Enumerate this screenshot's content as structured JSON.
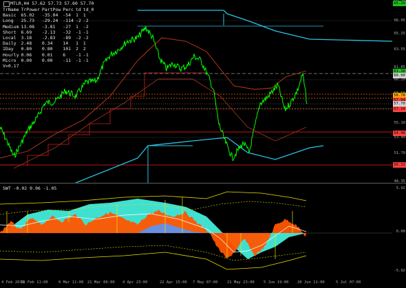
{
  "main": {
    "title": "MTLR,H4  57.62 57.73 57.60 57.70",
    "info_header": [
      "TrName",
      "TrPower",
      "PartPow",
      "Perc",
      "td",
      "td_0"
    ],
    "info_rows": [
      [
        "Basic",
        "65.02",
        "-35.04",
        "-54",
        "1",
        "1"
      ],
      [
        "Long",
        "25.73",
        "-29.24",
        "-114",
        "-2",
        "-2"
      ],
      [
        "Medium",
        "13.08",
        "-3.81",
        "-27",
        "1",
        "-2"
      ],
      [
        "Short",
        "6.69",
        "-2.13",
        "-32",
        "-1",
        "-1"
      ],
      [
        "Local",
        "3.18",
        "-2.83",
        "-89",
        "-2",
        "-2"
      ],
      [
        "Daily",
        "2.48",
        "0.34",
        "14",
        "1",
        "1"
      ],
      [
        "IDay",
        "0.80",
        "0.80",
        "101",
        "2",
        "2"
      ],
      [
        "Hourly",
        "0.06",
        "0.01",
        "6",
        "-1",
        "-1"
      ],
      [
        "Micro",
        "0.00",
        "0.00",
        "-11",
        "-1",
        "-1"
      ]
    ],
    "extra_label": "V=0.17",
    "price_labels": [
      "69.20",
      "66.95",
      "65.25",
      "63.55",
      "61.85",
      "60.20",
      "58.50",
      "56.80",
      "55.10",
      "53.40",
      "51.70",
      "50.00",
      "48.35"
    ],
    "price_tags": [
      {
        "text": "69.20",
        "color": "#20c020"
      },
      {
        "text": "61.38",
        "color": "#20c020"
      },
      {
        "text": "60.90",
        "color": "#d0d0d0"
      },
      {
        "text": "58.78",
        "color": "#ffaa00"
      },
      {
        "text": "57.94",
        "color": "#ff4040"
      },
      {
        "text": "57.70",
        "color": "#d0d0d0"
      },
      {
        "text": "57.34",
        "color": "#ff4040"
      },
      {
        "text": "54.48",
        "color": "#ff4040"
      },
      {
        "text": "50.31",
        "color": "#ff4040"
      }
    ]
  },
  "sub": {
    "title": "SWT -0.02 0.96 -1.05",
    "price_labels": [
      "5.92",
      "0.00",
      "-5.92"
    ]
  },
  "dates": [
    "4 Feb 2019",
    "19 Feb 11:00",
    "6 Mar 11:00",
    "21 Mar 06:00",
    "4 Apr 23:00",
    "22 Apr 15:00",
    "7 May 07:00",
    "21 May 23:00",
    "5 Jun 19:00",
    "20 Jun 11:00",
    "5 Jul 07:00"
  ],
  "colors": {
    "price": "#00ff00",
    "ma_fast": "#c83c1e",
    "ma_slow": "#a0301e",
    "band": "#29c5e6",
    "zone": "#ff6600",
    "swt_fill": "#40e0d0",
    "swt_orange": "#ff5500",
    "swt_blue": "#6a8ee0",
    "yellow": "#f0e000"
  }
}
